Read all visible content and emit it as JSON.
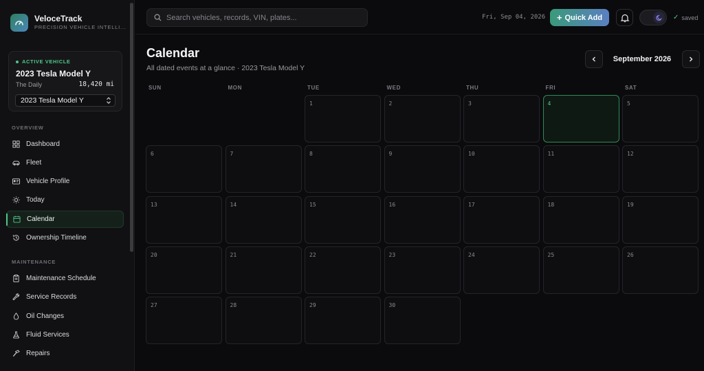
{
  "brand": {
    "name": "VeloceTrack",
    "tagline": "PRECISION VEHICLE INTELLI..."
  },
  "active_vehicle": {
    "label": "ACTIVE VEHICLE",
    "name": "2023 Tesla Model Y",
    "nickname": "The Daily",
    "mileage": "18,420 mi",
    "selected": "2023 Tesla Model Y"
  },
  "nav": {
    "overview_label": "OVERVIEW",
    "overview_items": [
      {
        "label": "Dashboard",
        "icon": "grid-icon"
      },
      {
        "label": "Fleet",
        "icon": "car-icon"
      },
      {
        "label": "Vehicle Profile",
        "icon": "id-card-icon"
      },
      {
        "label": "Today",
        "icon": "sun-icon"
      },
      {
        "label": "Calendar",
        "icon": "calendar-icon",
        "active": true
      },
      {
        "label": "Ownership Timeline",
        "icon": "history-icon"
      }
    ],
    "maintenance_label": "MAINTENANCE",
    "maintenance_items": [
      {
        "label": "Maintenance Schedule",
        "icon": "clipboard-icon"
      },
      {
        "label": "Service Records",
        "icon": "wrench-icon"
      },
      {
        "label": "Oil Changes",
        "icon": "droplet-icon"
      },
      {
        "label": "Fluid Services",
        "icon": "flask-icon"
      },
      {
        "label": "Repairs",
        "icon": "hammer-icon"
      }
    ]
  },
  "topbar": {
    "search_placeholder": "Search vehicles, records, VIN, plates...",
    "date": "Fri, Sep 04, 2026",
    "quick_add": "Quick Add",
    "saved": "saved"
  },
  "calendar": {
    "title": "Calendar",
    "subtitle": "All dated events at a glance · 2023 Tesla Model Y",
    "month": "September 2026",
    "weekdays": [
      "SUN",
      "MON",
      "TUE",
      "WED",
      "THU",
      "FRI",
      "SAT"
    ],
    "days": [
      "1",
      "2",
      "3",
      "4",
      "5",
      "6",
      "7",
      "8",
      "9",
      "10",
      "11",
      "12",
      "13",
      "14",
      "15",
      "16",
      "17",
      "18",
      "19",
      "20",
      "21",
      "22",
      "23",
      "24",
      "25",
      "26",
      "27",
      "28",
      "29",
      "30"
    ],
    "today": "4"
  },
  "colors": {
    "accent": "#4ec987",
    "background": "#0b0b0d"
  }
}
